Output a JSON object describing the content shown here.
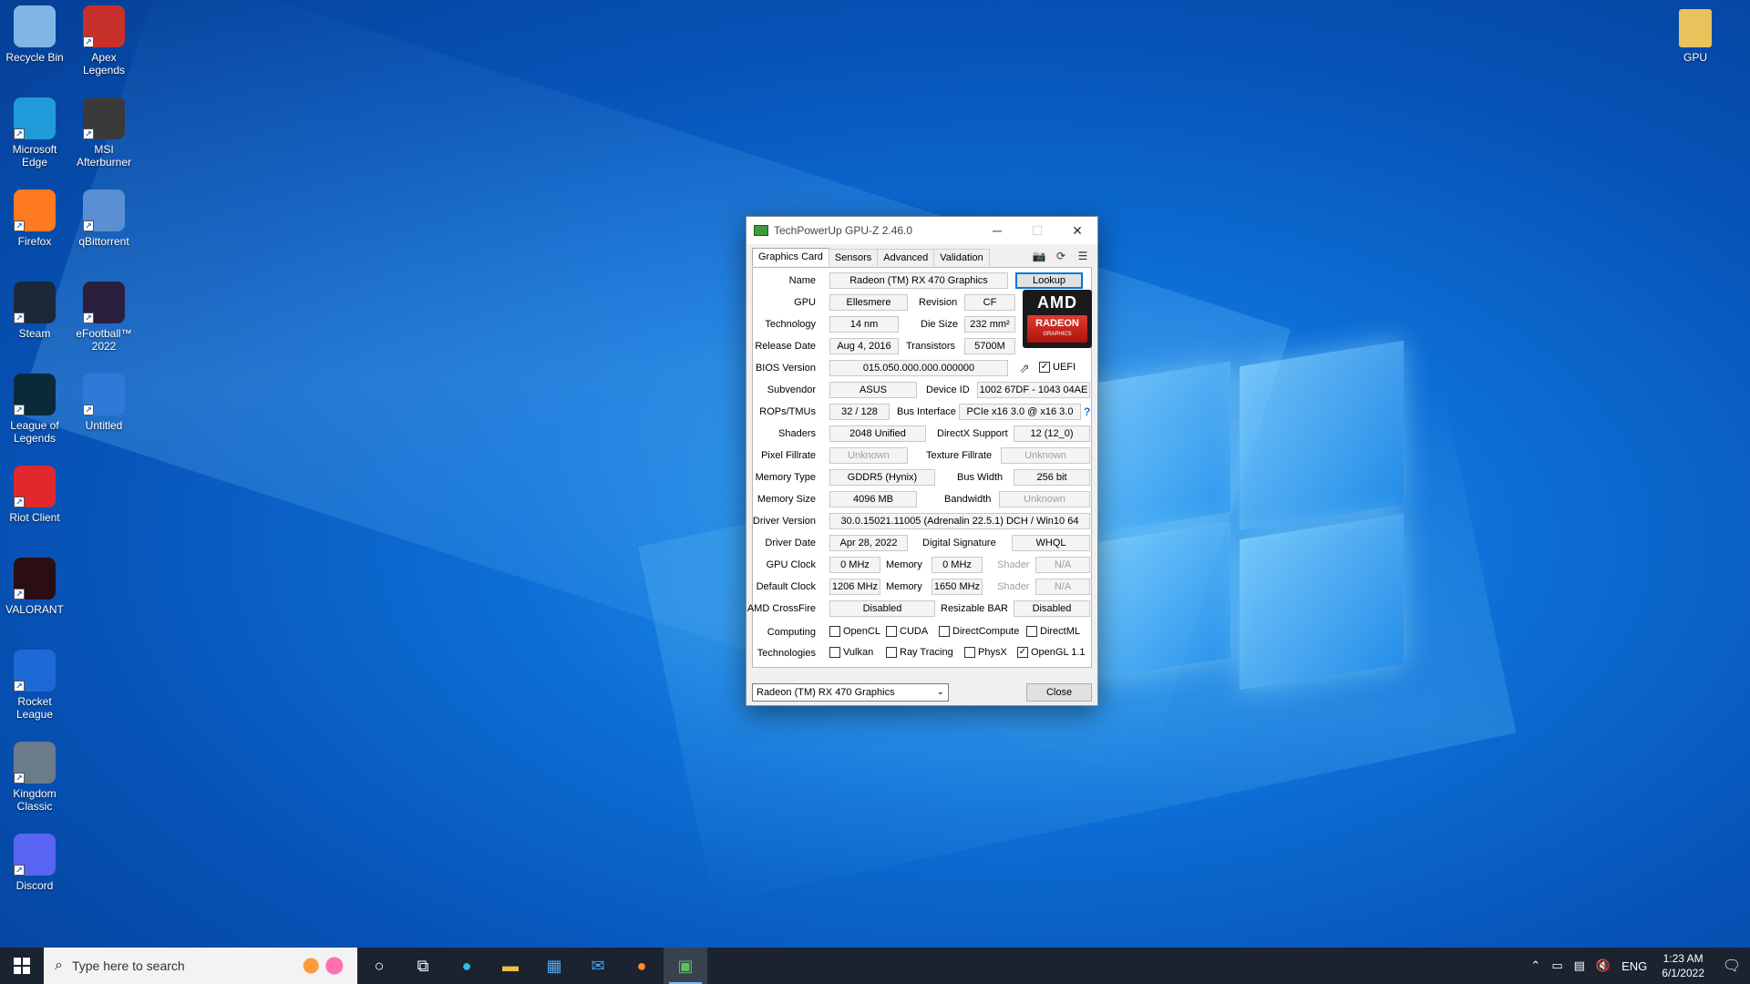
{
  "desktop": {
    "icons_left": [
      {
        "label": "Recycle Bin",
        "icon": "recycle-bin-icon",
        "color": "#7fb6e6"
      },
      {
        "label": "Apex Legends",
        "icon": "apex-legends-icon",
        "color": "#c8302b"
      },
      {
        "label": "Microsoft Edge",
        "icon": "edge-icon",
        "color": "#1f9bd9"
      },
      {
        "label": "MSI Afterburner",
        "icon": "msi-afterburner-icon",
        "color": "#3a3a3a"
      },
      {
        "label": "Firefox",
        "icon": "firefox-icon",
        "color": "#ff7a1f"
      },
      {
        "label": "qBittorrent",
        "icon": "qbittorrent-icon",
        "color": "#5b8fd3"
      },
      {
        "label": "Steam",
        "icon": "steam-icon",
        "color": "#1b2838"
      },
      {
        "label": "eFootball™ 2022",
        "icon": "efootball-icon",
        "color": "#2a1f3d"
      },
      {
        "label": "League of Legends",
        "icon": "league-of-legends-icon",
        "color": "#0a2a3a"
      },
      {
        "label": "Untitled",
        "icon": "untitled-icon",
        "color": "#2f7ad8"
      },
      {
        "label": "Riot Client",
        "icon": "riot-client-icon",
        "color": "#e0282d"
      },
      {
        "label": "VALORANT",
        "icon": "valorant-icon",
        "color": "#2b0d14"
      },
      {
        "label": "Rocket League",
        "icon": "rocket-league-icon",
        "color": "#1d6ad6"
      },
      {
        "label": "Kingdom Classic",
        "icon": "kingdom-classic-icon",
        "color": "#6b7b8a"
      },
      {
        "label": "Discord",
        "icon": "discord-icon",
        "color": "#5865f2"
      }
    ],
    "icon_right": {
      "label": "GPU",
      "icon": "folder-icon",
      "color": "#e8c25a"
    }
  },
  "gpuz": {
    "title": "TechPowerUp GPU-Z 2.46.0",
    "tabs": [
      "Graphics Card",
      "Sensors",
      "Advanced",
      "Validation"
    ],
    "labels": {
      "name": "Name",
      "gpu": "GPU",
      "revision": "Revision",
      "technology": "Technology",
      "die_size": "Die Size",
      "release_date": "Release Date",
      "transistors": "Transistors",
      "bios_version": "BIOS Version",
      "subvendor": "Subvendor",
      "device_id": "Device ID",
      "rops_tmus": "ROPs/TMUs",
      "bus_interface": "Bus Interface",
      "shaders": "Shaders",
      "directx": "DirectX Support",
      "pixel_fillrate": "Pixel Fillrate",
      "texture_fillrate": "Texture Fillrate",
      "memory_type": "Memory Type",
      "bus_width": "Bus Width",
      "memory_size": "Memory Size",
      "bandwidth": "Bandwidth",
      "driver_version": "Driver Version",
      "driver_date": "Driver Date",
      "digital_signature": "Digital Signature",
      "gpu_clock": "GPU Clock",
      "memory": "Memory",
      "shader": "Shader",
      "default_clock": "Default Clock",
      "crossfire": "AMD CrossFire",
      "resizable_bar": "Resizable BAR",
      "computing": "Computing",
      "technologies": "Technologies"
    },
    "values": {
      "name": "Radeon (TM) RX 470 Graphics",
      "gpu": "Ellesmere",
      "revision": "CF",
      "technology": "14 nm",
      "die_size": "232 mm²",
      "release_date": "Aug 4, 2016",
      "transistors": "5700M",
      "bios_version": "015.050.000.000.000000",
      "subvendor": "ASUS",
      "device_id": "1002 67DF - 1043 04AE",
      "rops_tmus": "32 / 128",
      "bus_interface": "PCIe x16 3.0 @ x16 3.0",
      "shaders": "2048 Unified",
      "directx": "12 (12_0)",
      "pixel_fillrate": "Unknown",
      "texture_fillrate": "Unknown",
      "memory_type": "GDDR5 (Hynix)",
      "bus_width": "256 bit",
      "memory_size": "4096 MB",
      "bandwidth": "Unknown",
      "driver_version": "30.0.15021.11005 (Adrenalin 22.5.1) DCH / Win10 64",
      "driver_date": "Apr 28, 2022",
      "digital_signature": "WHQL",
      "gpu_clock": "0 MHz",
      "gpu_memory": "0 MHz",
      "gpu_shader": "N/A",
      "default_clock": "1206 MHz",
      "default_memory": "1650 MHz",
      "default_shader": "N/A",
      "crossfire": "Disabled",
      "resizable_bar": "Disabled"
    },
    "lookup_label": "Lookup",
    "uefi": {
      "label": "UEFI",
      "checked": true
    },
    "logo": {
      "brand": "AMD",
      "line1": "RADEON",
      "line2": "GRAPHICS"
    },
    "computing": [
      {
        "label": "OpenCL",
        "checked": false
      },
      {
        "label": "CUDA",
        "checked": false
      },
      {
        "label": "DirectCompute",
        "checked": false
      },
      {
        "label": "DirectML",
        "checked": false
      }
    ],
    "technologies": [
      {
        "label": "Vulkan",
        "checked": false
      },
      {
        "label": "Ray Tracing",
        "checked": false
      },
      {
        "label": "PhysX",
        "checked": false
      },
      {
        "label": "OpenGL 1.1",
        "checked": true
      }
    ],
    "device_select": "Radeon (TM) RX 470 Graphics",
    "close_label": "Close"
  },
  "taskbar": {
    "search_placeholder": "Type here to search",
    "language": "ENG",
    "time": "1:23 AM",
    "date": "6/1/2022"
  }
}
